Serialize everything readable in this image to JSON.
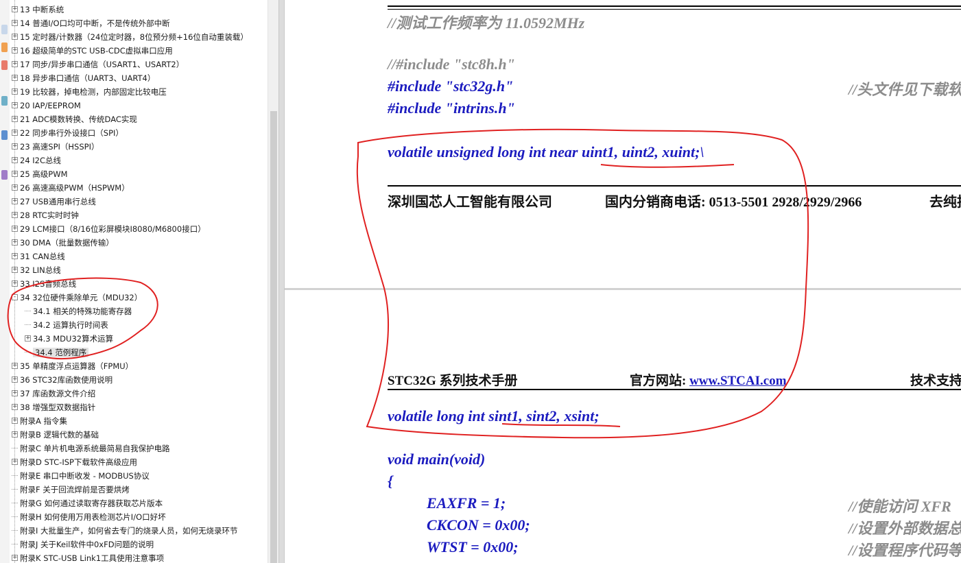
{
  "outline": {
    "items": [
      {
        "exp": "+",
        "indent": 0,
        "label": "13 中断系统"
      },
      {
        "exp": "+",
        "indent": 0,
        "label": "14 普通I/O口均可中断，不是传统外部中断"
      },
      {
        "exp": "+",
        "indent": 0,
        "label": "15 定时器/计数器（24位定时器，8位预分频+16位自动重装载）"
      },
      {
        "exp": "+",
        "indent": 0,
        "label": "16 超级简单的STC USB-CDC虚拟串口应用"
      },
      {
        "exp": "+",
        "indent": 0,
        "label": "17 同步/异步串口通信（USART1、USART2）"
      },
      {
        "exp": "+",
        "indent": 0,
        "label": "18 异步串口通信（UART3、UART4）"
      },
      {
        "exp": "+",
        "indent": 0,
        "label": "19 比较器，掉电检测，内部固定比较电压"
      },
      {
        "exp": "+",
        "indent": 0,
        "label": "20 IAP/EEPROM"
      },
      {
        "exp": "+",
        "indent": 0,
        "label": "21 ADC模数转换、传统DAC实现"
      },
      {
        "exp": "+",
        "indent": 0,
        "label": "22 同步串行外设接口（SPI）"
      },
      {
        "exp": "+",
        "indent": 0,
        "label": "23 高速SPI（HSSPI）"
      },
      {
        "exp": "+",
        "indent": 0,
        "label": "24 I2C总线"
      },
      {
        "exp": "+",
        "indent": 0,
        "label": "25 高级PWM"
      },
      {
        "exp": "+",
        "indent": 0,
        "label": "26 高速高级PWM（HSPWM）"
      },
      {
        "exp": "+",
        "indent": 0,
        "label": "27 USB通用串行总线"
      },
      {
        "exp": "+",
        "indent": 0,
        "label": "28 RTC实时时钟"
      },
      {
        "exp": "+",
        "indent": 0,
        "label": "29 LCM接口（8/16位彩屏模块I8080/M6800接口）"
      },
      {
        "exp": "+",
        "indent": 0,
        "label": "30 DMA（批量数据传输）"
      },
      {
        "exp": "+",
        "indent": 0,
        "label": "31 CAN总线"
      },
      {
        "exp": "+",
        "indent": 0,
        "label": "32 LIN总线"
      },
      {
        "exp": "+",
        "indent": 0,
        "label": "33 I2S音频总线"
      },
      {
        "exp": "-",
        "indent": 0,
        "label": "34 32位硬件乘除单元（MDU32）"
      },
      {
        "exp": "",
        "indent": 1,
        "label": "34.1 相关的特殊功能寄存器"
      },
      {
        "exp": "",
        "indent": 1,
        "label": "34.2 运算执行时间表"
      },
      {
        "exp": "+",
        "indent": 1,
        "label": "34.3 MDU32算术运算"
      },
      {
        "exp": "",
        "indent": 1,
        "label": "34.4 范例程序",
        "selected": true
      },
      {
        "exp": "+",
        "indent": 0,
        "label": "35 单精度浮点运算器（FPMU）"
      },
      {
        "exp": "+",
        "indent": 0,
        "label": "36 STC32库函数使用说明"
      },
      {
        "exp": "+",
        "indent": 0,
        "label": "37 库函数源文件介绍"
      },
      {
        "exp": "+",
        "indent": 0,
        "label": "38 增强型双数据指针"
      },
      {
        "exp": "+",
        "indent": 0,
        "label": "附录A 指令集"
      },
      {
        "exp": "+",
        "indent": 0,
        "label": "附录B 逻辑代数的基础"
      },
      {
        "exp": "",
        "indent": 0,
        "label": "附录C 单片机电源系统最简易自我保护电路"
      },
      {
        "exp": "+",
        "indent": 0,
        "label": "附录D STC-ISP下载软件高级应用"
      },
      {
        "exp": "",
        "indent": 0,
        "label": "附录E 串口中断收发 - MODBUS协议"
      },
      {
        "exp": "",
        "indent": 0,
        "label": "附录F 关于回流焊前是否要烘烤"
      },
      {
        "exp": "",
        "indent": 0,
        "label": "附录G 如何通过读取寄存器获取芯片版本"
      },
      {
        "exp": "",
        "indent": 0,
        "label": "附录H 如何使用万用表检测芯片I/O口好坏"
      },
      {
        "exp": "",
        "indent": 0,
        "label": "附录I 大批量生产，如何省去专门的烧录人员，如何无烧录环节"
      },
      {
        "exp": "",
        "indent": 0,
        "label": "附录J 关于Keil软件中0xFD问题的说明"
      },
      {
        "exp": "+",
        "indent": 0,
        "label": "附录K STC-USB Link1工具使用注意事项"
      }
    ]
  },
  "document": {
    "comment_freq": "//测试工作频率为 11.0592MHz",
    "comment_include": "//#include \"stc8h.h\"",
    "include_stc32g": "#include \"stc32g.h\"",
    "comment_header": "//头文件见下载软件",
    "include_intrins": "#include \"intrins.h\"",
    "decl_uint_prefix": "volatile unsigned long int near ",
    "decl_uint_vars": "uint1, uint2, xuint;\\",
    "footer_company": "深圳国芯人工智能有限公司",
    "footer_phone": "国内分销商电话: 0513-5501 2928/2929/2966",
    "footer_tail": "去纯技",
    "header_manual": "STC32G 系列技术手册",
    "header_site_label": "官方网站: ",
    "header_site_link": "www.STCAI.com",
    "header_support": "技术支持",
    "decl_sint_prefix": "volatile long int ",
    "decl_sint_vars": "sint1, sint2, xsint;",
    "main_sig": "void main(void)",
    "brace_open": "{",
    "stmt_eaxfr": "EAXFR = 1;",
    "comment_eaxfr": "//使能访问 XFR",
    "stmt_ckcon": "CKCON = 0x00;",
    "comment_ckcon": "//设置外部数据总",
    "stmt_wtst": "WTST = 0x00;",
    "comment_wtst": "//设置程序代码等"
  },
  "colors": {
    "code_blue": "#1b1bbf",
    "comment_gray": "#8c8c8c",
    "annotation_red": "#e02020"
  }
}
